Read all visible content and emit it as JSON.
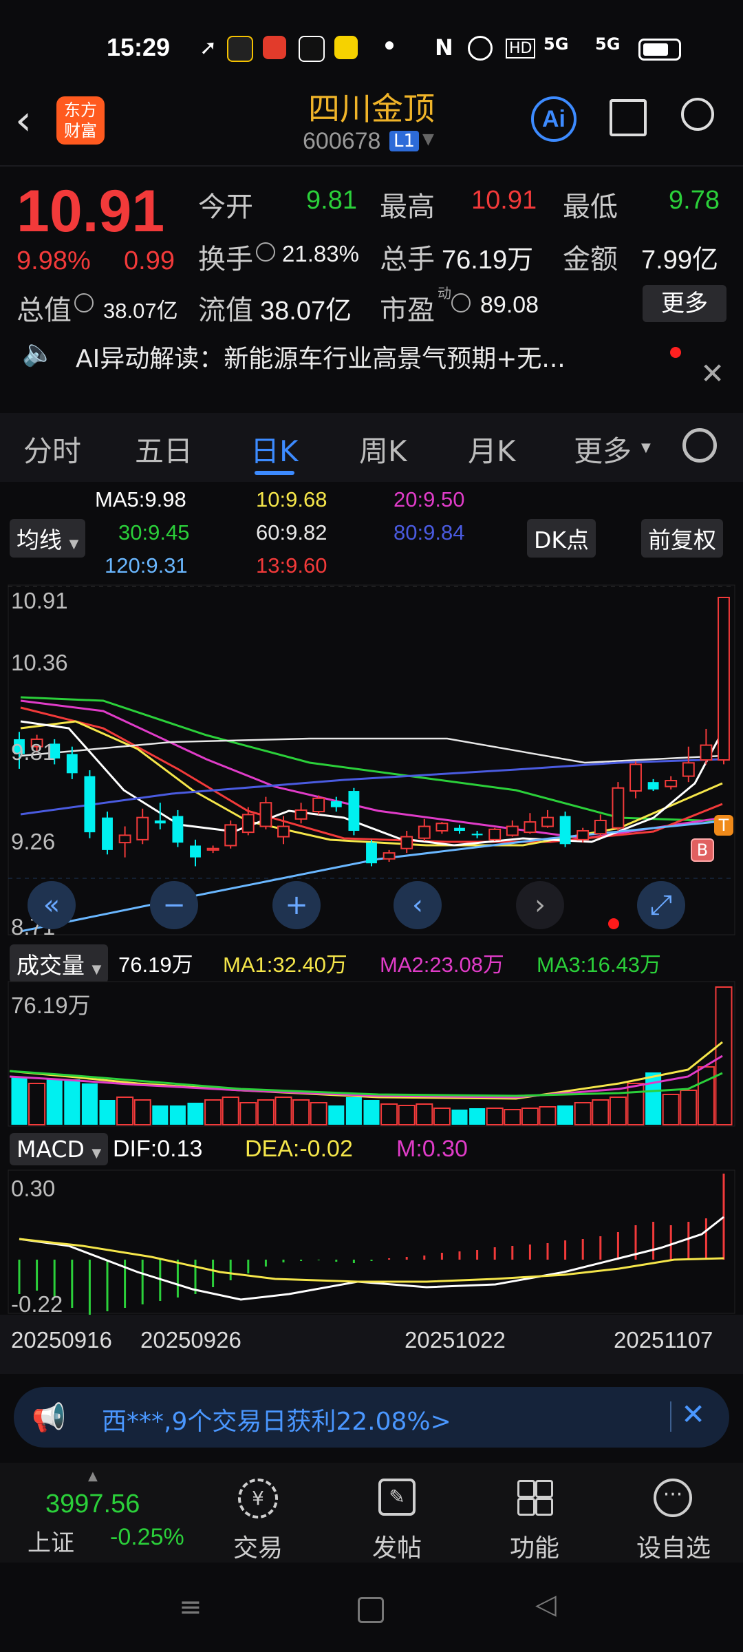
{
  "status": {
    "time": "15:29",
    "network": "5G"
  },
  "header": {
    "title": "四川金顶",
    "code": "600678",
    "badge": "L1",
    "logo_line1": "东方",
    "logo_line2": "财富",
    "ai_label": "Ai"
  },
  "quote": {
    "price": "10.91",
    "change_pct": "9.98%",
    "change": "0.99",
    "open_label": "今开",
    "open": "9.81",
    "high_label": "最高",
    "high": "10.91",
    "low_label": "最低",
    "low": "9.78",
    "turnover_label": "换手",
    "turnover": "21.83%",
    "volume_label": "总手",
    "volume": "76.19万",
    "amount_label": "金额",
    "amount": "7.99亿",
    "mktcap_label": "总值",
    "mktcap": "38.07亿",
    "float_label": "流值",
    "float_cap": "38.07亿",
    "pe_label": "市盈",
    "pe_sup": "动",
    "pe": "89.08",
    "more_button": "更多"
  },
  "ai_notice": {
    "text": "AI异动解读：新能源车行业高景气预期+无..."
  },
  "tabs": [
    "分时",
    "五日",
    "日K",
    "周K",
    "月K",
    "更多"
  ],
  "active_tab": "日K",
  "ma_legend": {
    "ma_chip": "均线",
    "ma5": "MA5:9.98",
    "ma10": "10:9.68",
    "ma20": "20:9.50",
    "ma30": "30:9.45",
    "ma60": "60:9.82",
    "ma80": "80:9.84",
    "ma120": "120:9.31",
    "ma13": "13:9.60",
    "dk_chip": "DK点",
    "adjust_chip": "前复权"
  },
  "price_axis": {
    "top": "10.91",
    "upper": "10.36",
    "mid": "9.81",
    "lower": "9.26",
    "bottom": "8.71"
  },
  "markers": {
    "b": "B",
    "t": "T"
  },
  "volume_legend": {
    "chip": "成交量",
    "vol": "76.19万",
    "ma1": "MA1:32.40万",
    "ma2": "MA2:23.08万",
    "ma3": "MA3:16.43万",
    "axis_top": "76.19万"
  },
  "macd_legend": {
    "chip": "MACD",
    "dif": "DIF:0.13",
    "dea": "DEA:-0.02",
    "m": "M:0.30",
    "axis_top": "0.30",
    "axis_bottom": "-0.22"
  },
  "dates": [
    "20250916",
    "20250926",
    "20251022",
    "20251107"
  ],
  "banner": {
    "text": "西***,9个交易日获利22.08%>"
  },
  "bottom": {
    "index_value": "3997.56",
    "index_name": "上证",
    "index_change": "-0.25%",
    "items": [
      "交易",
      "发帖",
      "功能",
      "设自选"
    ]
  },
  "colors": {
    "up": "#f23a3a",
    "down": "#00f0f0",
    "accent": "#3d8bff",
    "gold": "#f0b429"
  },
  "chart_data": {
    "type": "candlestick",
    "ylim": [
      8.71,
      10.91
    ],
    "candles": [
      {
        "o": 9.95,
        "c": 9.85,
        "h": 10.0,
        "l": 9.75
      },
      {
        "o": 9.9,
        "c": 9.95,
        "h": 9.98,
        "l": 9.86
      },
      {
        "o": 9.92,
        "c": 9.82,
        "h": 9.95,
        "l": 9.78
      },
      {
        "o": 9.85,
        "c": 9.72,
        "h": 9.9,
        "l": 9.68
      },
      {
        "o": 9.7,
        "c": 9.32,
        "h": 9.74,
        "l": 9.28
      },
      {
        "o": 9.42,
        "c": 9.2,
        "h": 9.46,
        "l": 9.17
      },
      {
        "o": 9.25,
        "c": 9.3,
        "h": 9.36,
        "l": 9.15
      },
      {
        "o": 9.27,
        "c": 9.42,
        "h": 9.48,
        "l": 9.24
      },
      {
        "o": 9.4,
        "c": 9.38,
        "h": 9.52,
        "l": 9.34
      },
      {
        "o": 9.43,
        "c": 9.25,
        "h": 9.47,
        "l": 9.22
      },
      {
        "o": 9.23,
        "c": 9.15,
        "h": 9.27,
        "l": 9.09
      },
      {
        "o": 9.2,
        "c": 9.21,
        "h": 9.23,
        "l": 9.18
      },
      {
        "o": 9.23,
        "c": 9.37,
        "h": 9.4,
        "l": 9.21
      },
      {
        "o": 9.32,
        "c": 9.44,
        "h": 9.49,
        "l": 9.3
      },
      {
        "o": 9.36,
        "c": 9.52,
        "h": 9.56,
        "l": 9.34
      },
      {
        "o": 9.29,
        "c": 9.36,
        "h": 9.43,
        "l": 9.24
      },
      {
        "o": 9.41,
        "c": 9.47,
        "h": 9.52,
        "l": 9.38
      },
      {
        "o": 9.46,
        "c": 9.55,
        "h": 9.57,
        "l": 9.44
      },
      {
        "o": 9.53,
        "c": 9.49,
        "h": 9.56,
        "l": 9.46
      },
      {
        "o": 9.6,
        "c": 9.33,
        "h": 9.62,
        "l": 9.3
      },
      {
        "o": 9.25,
        "c": 9.11,
        "h": 9.27,
        "l": 9.09
      },
      {
        "o": 9.14,
        "c": 9.18,
        "h": 9.2,
        "l": 9.12
      },
      {
        "o": 9.21,
        "c": 9.29,
        "h": 9.33,
        "l": 9.18
      },
      {
        "o": 9.28,
        "c": 9.36,
        "h": 9.41,
        "l": 9.26
      },
      {
        "o": 9.33,
        "c": 9.38,
        "h": 9.39,
        "l": 9.31
      },
      {
        "o": 9.35,
        "c": 9.33,
        "h": 9.37,
        "l": 9.31
      },
      {
        "o": 9.31,
        "c": 9.3,
        "h": 9.33,
        "l": 9.28
      },
      {
        "o": 9.27,
        "c": 9.34,
        "h": 9.35,
        "l": 9.26
      },
      {
        "o": 9.3,
        "c": 9.36,
        "h": 9.4,
        "l": 9.29
      },
      {
        "o": 9.32,
        "c": 9.39,
        "h": 9.45,
        "l": 9.31
      },
      {
        "o": 9.36,
        "c": 9.42,
        "h": 9.47,
        "l": 9.35
      },
      {
        "o": 9.43,
        "c": 9.24,
        "h": 9.46,
        "l": 9.22
      },
      {
        "o": 9.27,
        "c": 9.33,
        "h": 9.35,
        "l": 9.25
      },
      {
        "o": 9.31,
        "c": 9.4,
        "h": 9.44,
        "l": 9.29
      },
      {
        "o": 9.35,
        "c": 9.62,
        "h": 9.66,
        "l": 9.33
      },
      {
        "o": 9.6,
        "c": 9.78,
        "h": 9.8,
        "l": 9.55
      },
      {
        "o": 9.66,
        "c": 9.61,
        "h": 9.68,
        "l": 9.6
      },
      {
        "o": 9.63,
        "c": 9.67,
        "h": 9.7,
        "l": 9.61
      },
      {
        "o": 9.7,
        "c": 9.79,
        "h": 9.9,
        "l": 9.66
      },
      {
        "o": 9.81,
        "c": 9.91,
        "h": 10.02,
        "l": 9.78
      },
      {
        "o": 9.81,
        "c": 10.91,
        "h": 10.91,
        "l": 9.78
      }
    ]
  }
}
